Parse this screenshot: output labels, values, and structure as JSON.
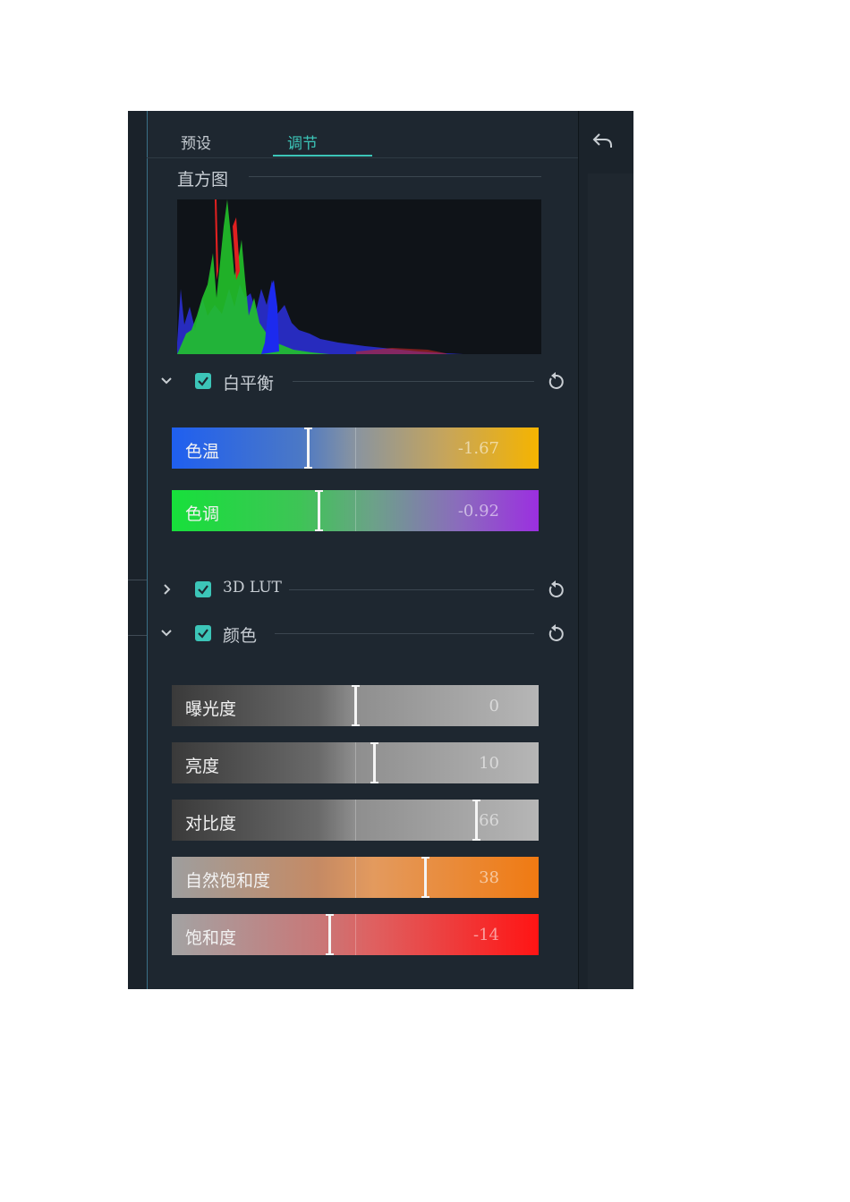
{
  "tabs": [
    {
      "label": "预设",
      "active": false
    },
    {
      "label": "调节",
      "active": true
    }
  ],
  "histogram": {
    "title": "直方图"
  },
  "sections": {
    "white_balance": {
      "label": "白平衡",
      "checked": true,
      "expanded": true
    },
    "lut": {
      "label": "3D LUT",
      "checked": true,
      "expanded": false
    },
    "color": {
      "label": "颜色",
      "checked": true,
      "expanded": true
    }
  },
  "white_balance_sliders": [
    {
      "label": "色温",
      "value": "-1.67",
      "position": 0.37
    },
    {
      "label": "色调",
      "value": "-0.92",
      "position": 0.4
    }
  ],
  "color_sliders": [
    {
      "label": "曝光度",
      "value": "0",
      "position": 0.5
    },
    {
      "label": "亮度",
      "value": "10",
      "position": 0.55
    },
    {
      "label": "对比度",
      "value": "66",
      "position": 0.83
    },
    {
      "label": "自然饱和度",
      "value": "38",
      "position": 0.69
    },
    {
      "label": "饱和度",
      "value": "-14",
      "position": 0.43
    }
  ],
  "colors": {
    "accent": "#3cc5b8",
    "panel_bg": "#1e2730",
    "temperature_gradient": [
      "#1f5ff0",
      "#f5b400"
    ],
    "tint_gradient": [
      "#17e03b",
      "#9b2fe0"
    ],
    "vibrance_gradient": [
      "#9e9e9e",
      "#f07a12"
    ],
    "saturation_gradient": [
      "#a3a3a3",
      "#ff1414"
    ]
  },
  "icons": {
    "undo": "undo-icon",
    "reset": "reset-icon",
    "expand": "chevron-down-icon",
    "collapse": "chevron-right-icon",
    "checkbox": "checkbox-checked-icon"
  }
}
